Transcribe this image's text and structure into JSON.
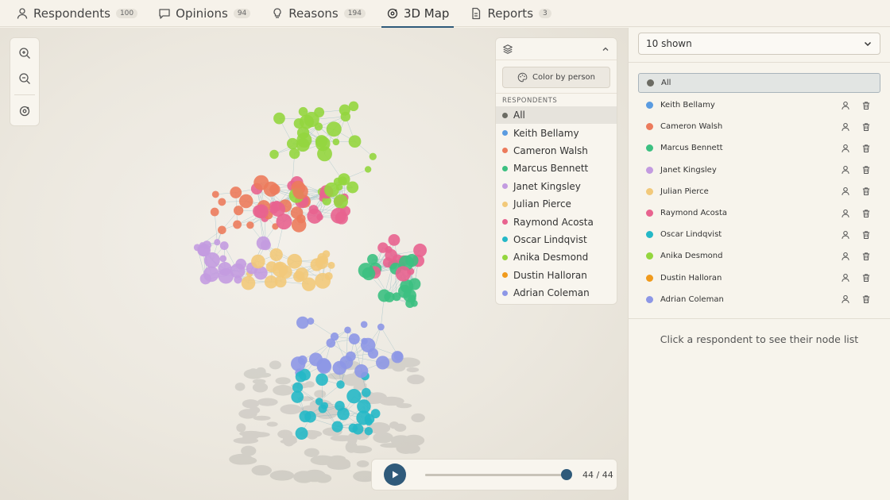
{
  "tabs": [
    {
      "label": "Respondents",
      "count": "100",
      "icon": "person-icon"
    },
    {
      "label": "Opinions",
      "count": "94",
      "icon": "speech-bubble-icon"
    },
    {
      "label": "Reasons",
      "count": "194",
      "icon": "lightbulb-icon"
    },
    {
      "label": "3D Map",
      "count": "",
      "icon": "orbit-icon"
    },
    {
      "label": "Reports",
      "count": "3",
      "icon": "document-icon"
    }
  ],
  "active_tab": "3D Map",
  "layers": {
    "color_by_label": "Color by person",
    "section_label": "RESPONDENTS",
    "items": [
      {
        "name": "All",
        "color": "#6b6b63"
      },
      {
        "name": "Keith Bellamy",
        "color": "#5a9be0"
      },
      {
        "name": "Cameron Walsh",
        "color": "#ec7b5c"
      },
      {
        "name": "Marcus Bennett",
        "color": "#3cc081"
      },
      {
        "name": "Janet Kingsley",
        "color": "#c39be0"
      },
      {
        "name": "Julian Pierce",
        "color": "#f2c97a"
      },
      {
        "name": "Raymond Acosta",
        "color": "#e8638f"
      },
      {
        "name": "Oscar Lindqvist",
        "color": "#25b8c7"
      },
      {
        "name": "Anika Desmond",
        "color": "#94d63e"
      },
      {
        "name": "Dustin Halloran",
        "color": "#f09a1c"
      },
      {
        "name": "Adrian Coleman",
        "color": "#8d97e6"
      }
    ]
  },
  "player": {
    "frame": "44 / 44",
    "progress": 1.0
  },
  "right_panel": {
    "filter_value": "10 shown",
    "hint": "Click a respondent to see their node list"
  },
  "colors": {
    "accent": "#2f5a7a"
  }
}
